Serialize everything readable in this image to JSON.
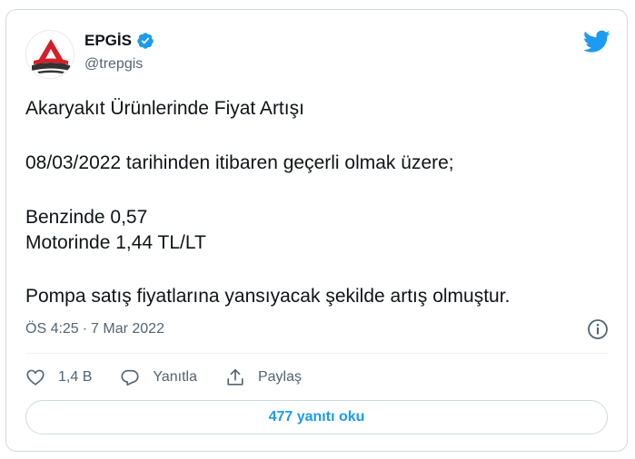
{
  "tweet": {
    "display_name": "EPGİS",
    "handle": "@trepgis",
    "lines": [
      "Akaryakıt Ürünlerinde Fiyat Artışı",
      "08/03/2022 tarihinden itibaren geçerli olmak üzere;",
      "Benzinde 0,57",
      "Motorinde 1,44 TL/LT",
      "Pompa satış fiyatlarına yansıyacak şekilde artış olmuştur."
    ],
    "time": "ÖS 4:25",
    "separator": "·",
    "date": "7 Mar 2022"
  },
  "actions": {
    "likes_count": "1,4 B",
    "reply_label": "Yanıtla",
    "share_label": "Paylaş"
  },
  "read_replies_label": "477 yanıtı oku",
  "colors": {
    "accent": "#1d9bf0",
    "muted": "#536471",
    "border": "#cfd9de",
    "logo_red": "#d3202a",
    "logo_dark": "#333333"
  },
  "icons": [
    "epgis-logo",
    "verified-icon",
    "twitter-bird-icon",
    "info-icon",
    "heart-icon",
    "reply-icon",
    "share-icon"
  ]
}
